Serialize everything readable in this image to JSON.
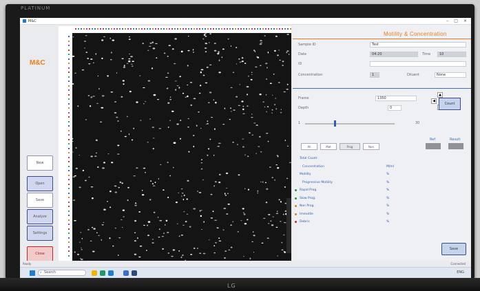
{
  "monitor": {
    "top_brand": "PLATINUM",
    "bottom_brand": "LG"
  },
  "window": {
    "title": "M&C",
    "controls": [
      "–",
      "□",
      "×"
    ]
  },
  "sidebar": {
    "logo": "M&C",
    "buttons": [
      {
        "id": "new",
        "label": "New"
      },
      {
        "id": "open",
        "label": "Open"
      },
      {
        "id": "save",
        "label": "Save"
      },
      {
        "id": "analyze",
        "label": "Analyze"
      },
      {
        "id": "settings",
        "label": "Settings"
      },
      {
        "id": "close",
        "label": "Close"
      }
    ]
  },
  "header": {
    "title": "Motility & Concentration"
  },
  "form": {
    "field1": {
      "label": "Sample ID",
      "value": "Test"
    },
    "field2": {
      "label": "Date",
      "value": "04-20",
      "label2": "Time",
      "value2": "10"
    },
    "field3": {
      "label": "ID",
      "value": ""
    },
    "field4": {
      "label": "Concentration",
      "value": "1",
      "label2": "Diluent",
      "value2": "None"
    }
  },
  "controls": {
    "frame_label": "Frame",
    "frame_value": "1350",
    "depth_label": "Depth",
    "depth_value": "0",
    "count_button": "Count",
    "slider_min": "1",
    "slider_max": "30",
    "nav_up": "▲",
    "nav_down": "▼",
    "nav_left": "◀",
    "nav_right": "▶"
  },
  "results": {
    "tabs": [
      "All",
      "Mot",
      "Prog",
      "Non"
    ],
    "col1": "Ref",
    "col2": "Result",
    "rows": [
      {
        "label": "Total Count",
        "value": "",
        "dot": ""
      },
      {
        "label": "Concentration",
        "value": "M/ml",
        "dot": ""
      },
      {
        "label": "Motility",
        "value": "%",
        "dot": ""
      },
      {
        "label": "Progressive Motility",
        "value": "%",
        "dot": ""
      },
      {
        "label": "Rapid Prog.",
        "value": "%",
        "dot": "#2e8b3a"
      },
      {
        "label": "Slow Prog.",
        "value": "%",
        "dot": "#2e8b3a"
      },
      {
        "label": "Non Prog.",
        "value": "%",
        "dot": "#e07b1a"
      },
      {
        "label": "Immotile",
        "value": "%",
        "dot": "#e07b1a"
      },
      {
        "label": "Debris",
        "value": "%",
        "dot": "#d32020"
      }
    ],
    "save_button": "Save"
  },
  "status": {
    "left": "Ready",
    "right": "Connected"
  },
  "taskbar": {
    "search_placeholder": "Search",
    "tray_text": "ENG"
  },
  "colors": {
    "accent": "#f07b1a",
    "primary_blue": "#3b6fb6",
    "image_bg": "#141414"
  }
}
